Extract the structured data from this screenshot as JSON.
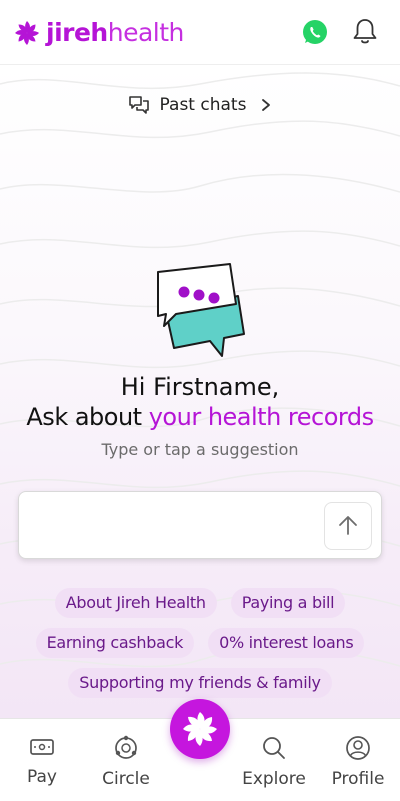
{
  "header": {
    "brand_bold": "jireh",
    "brand_light": "health",
    "whatsapp_icon": "whatsapp-icon",
    "notification_icon": "bell-icon"
  },
  "past_chats": {
    "label": "Past chats"
  },
  "greeting": {
    "line1": "Hi Firstname,",
    "line2_prefix": "Ask about ",
    "line2_highlight": "your health records",
    "hint": "Type or tap a suggestion"
  },
  "chat_input": {
    "value": "",
    "placeholder": ""
  },
  "suggestions": [
    [
      "About Jireh Health",
      "Paying a bill"
    ],
    [
      "Earning cashback",
      "0% interest loans"
    ],
    [
      "Supporting my friends & family"
    ]
  ],
  "nav": {
    "items": [
      {
        "label": "Pay",
        "icon": "wallet-icon"
      },
      {
        "label": "Circle",
        "icon": "circle-icon"
      },
      {
        "label": "Explore",
        "icon": "search-icon"
      },
      {
        "label": "Profile",
        "icon": "profile-icon"
      }
    ],
    "center_icon": "jireh-logo-icon"
  },
  "colors": {
    "brand": "#b514d6",
    "chip_bg": "#f1dff5",
    "chip_text": "#6a1a8a",
    "accent_teal": "#5fd0c8",
    "whatsapp": "#25d366"
  }
}
